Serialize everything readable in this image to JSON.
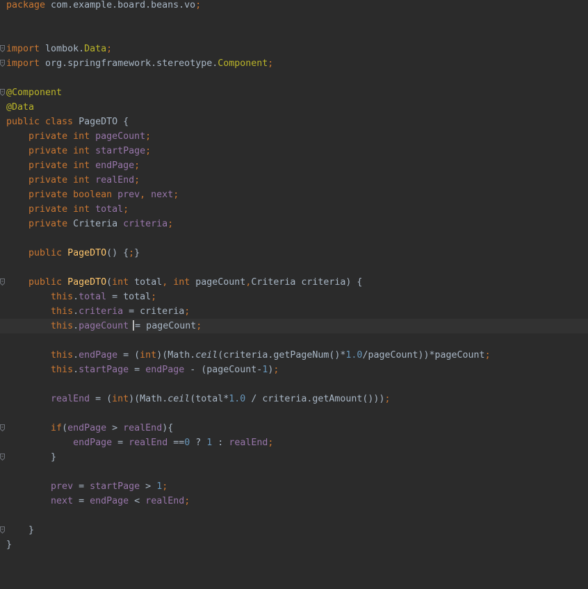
{
  "editor": {
    "language": "Java",
    "colors": {
      "background": "#2b2b2b",
      "current_line": "#323232",
      "keyword": "#cc7832",
      "field": "#9876aa",
      "number": "#6897bb",
      "annotation": "#bbb529",
      "method_decl": "#ffc66d",
      "text": "#a9b7c6"
    },
    "lines": [
      {
        "tokens": [
          [
            "kw",
            "package"
          ],
          [
            "pkg",
            " com.example.board.beans.vo"
          ],
          [
            "pun",
            ";"
          ]
        ]
      },
      {
        "tokens": []
      },
      {
        "tokens": []
      },
      {
        "fold": true,
        "tokens": [
          [
            "kw",
            "import"
          ],
          [
            "pkg",
            " lombok."
          ],
          [
            "ann",
            "Data"
          ],
          [
            "pun",
            ";"
          ]
        ]
      },
      {
        "fold": true,
        "tokens": [
          [
            "kw",
            "import"
          ],
          [
            "pkg",
            " org.springframework.stereotype."
          ],
          [
            "ann",
            "Component"
          ],
          [
            "pun",
            ";"
          ]
        ]
      },
      {
        "tokens": []
      },
      {
        "fold": true,
        "tokens": [
          [
            "ann",
            "@Component"
          ]
        ]
      },
      {
        "tokens": [
          [
            "ann",
            "@Data"
          ]
        ]
      },
      {
        "tokens": [
          [
            "kw",
            "public class "
          ],
          [
            "ty",
            "PageDTO {"
          ]
        ]
      },
      {
        "tokens": [
          [
            "ty",
            "    "
          ],
          [
            "kw",
            "private int "
          ],
          [
            "fld",
            "pageCount"
          ],
          [
            "pun",
            ";"
          ]
        ]
      },
      {
        "tokens": [
          [
            "ty",
            "    "
          ],
          [
            "kw",
            "private int "
          ],
          [
            "fld",
            "startPage"
          ],
          [
            "pun",
            ";"
          ]
        ]
      },
      {
        "tokens": [
          [
            "ty",
            "    "
          ],
          [
            "kw",
            "private int "
          ],
          [
            "fld",
            "endPage"
          ],
          [
            "pun",
            ";"
          ]
        ]
      },
      {
        "tokens": [
          [
            "ty",
            "    "
          ],
          [
            "kw",
            "private int "
          ],
          [
            "fld",
            "realEnd"
          ],
          [
            "pun",
            ";"
          ]
        ]
      },
      {
        "tokens": [
          [
            "ty",
            "    "
          ],
          [
            "kw",
            "private boolean "
          ],
          [
            "fld",
            "prev"
          ],
          [
            "pun",
            ", "
          ],
          [
            "fld",
            "next"
          ],
          [
            "pun",
            ";"
          ]
        ]
      },
      {
        "tokens": [
          [
            "ty",
            "    "
          ],
          [
            "kw",
            "private int "
          ],
          [
            "fld",
            "total"
          ],
          [
            "pun",
            ";"
          ]
        ]
      },
      {
        "tokens": [
          [
            "ty",
            "    "
          ],
          [
            "kw",
            "private "
          ],
          [
            "ty",
            "Criteria "
          ],
          [
            "fld",
            "criteria"
          ],
          [
            "pun",
            ";"
          ]
        ]
      },
      {
        "tokens": []
      },
      {
        "tokens": [
          [
            "ty",
            "    "
          ],
          [
            "kw",
            "public "
          ],
          [
            "mth",
            "PageDTO"
          ],
          [
            "ty",
            "() {"
          ],
          [
            "pun",
            ";"
          ],
          [
            "ty",
            "}"
          ]
        ]
      },
      {
        "tokens": []
      },
      {
        "fold": true,
        "tokens": [
          [
            "ty",
            "    "
          ],
          [
            "kw",
            "public "
          ],
          [
            "mth",
            "PageDTO"
          ],
          [
            "ty",
            "("
          ],
          [
            "kw",
            "int "
          ],
          [
            "ty",
            "total"
          ],
          [
            "pun",
            ", "
          ],
          [
            "kw",
            "int "
          ],
          [
            "ty",
            "pageCount"
          ],
          [
            "pun",
            ","
          ],
          [
            "ty",
            "Criteria criteria) {"
          ]
        ]
      },
      {
        "tokens": [
          [
            "ty",
            "        "
          ],
          [
            "kw",
            "this"
          ],
          [
            "ty",
            "."
          ],
          [
            "fld",
            "total"
          ],
          [
            "ty",
            " = total"
          ],
          [
            "pun",
            ";"
          ]
        ]
      },
      {
        "tokens": [
          [
            "ty",
            "        "
          ],
          [
            "kw",
            "this"
          ],
          [
            "ty",
            "."
          ],
          [
            "fld",
            "criteria"
          ],
          [
            "ty",
            " = criteria"
          ],
          [
            "pun",
            ";"
          ]
        ]
      },
      {
        "current": true,
        "caret_after": 4,
        "tokens": [
          [
            "ty",
            "        "
          ],
          [
            "kw",
            "this"
          ],
          [
            "ty",
            "."
          ],
          [
            "fld",
            "pageCount"
          ],
          [
            "ty",
            " = pageCount"
          ],
          [
            "pun",
            ";"
          ]
        ]
      },
      {
        "tokens": []
      },
      {
        "tokens": [
          [
            "ty",
            "        "
          ],
          [
            "kw",
            "this"
          ],
          [
            "ty",
            "."
          ],
          [
            "fld",
            "endPage"
          ],
          [
            "ty",
            " = ("
          ],
          [
            "kw",
            "int"
          ],
          [
            "ty",
            ")(Math."
          ],
          [
            "sta",
            "ceil"
          ],
          [
            "ty",
            "(criteria.getPageNum()*"
          ],
          [
            "num",
            "1.0"
          ],
          [
            "ty",
            "/pageCount))*pageCount"
          ],
          [
            "pun",
            ";"
          ]
        ]
      },
      {
        "tokens": [
          [
            "ty",
            "        "
          ],
          [
            "kw",
            "this"
          ],
          [
            "ty",
            "."
          ],
          [
            "fld",
            "startPage"
          ],
          [
            "ty",
            " = "
          ],
          [
            "fld",
            "endPage"
          ],
          [
            "ty",
            " - (pageCount-"
          ],
          [
            "num",
            "1"
          ],
          [
            "ty",
            ")"
          ],
          [
            "pun",
            ";"
          ]
        ]
      },
      {
        "tokens": []
      },
      {
        "tokens": [
          [
            "ty",
            "        "
          ],
          [
            "fld",
            "realEnd"
          ],
          [
            "ty",
            " = ("
          ],
          [
            "kw",
            "int"
          ],
          [
            "ty",
            ")(Math."
          ],
          [
            "sta",
            "ceil"
          ],
          [
            "ty",
            "(total*"
          ],
          [
            "num",
            "1.0"
          ],
          [
            "ty",
            " / criteria.getAmount()))"
          ],
          [
            "pun",
            ";"
          ]
        ]
      },
      {
        "tokens": []
      },
      {
        "fold": true,
        "tokens": [
          [
            "ty",
            "        "
          ],
          [
            "kw",
            "if"
          ],
          [
            "ty",
            "("
          ],
          [
            "fld",
            "endPage"
          ],
          [
            "ty",
            " > "
          ],
          [
            "fld",
            "realEnd"
          ],
          [
            "ty",
            "){"
          ]
        ]
      },
      {
        "tokens": [
          [
            "ty",
            "            "
          ],
          [
            "fld",
            "endPage"
          ],
          [
            "ty",
            " = "
          ],
          [
            "fld",
            "realEnd"
          ],
          [
            "ty",
            " =="
          ],
          [
            "num",
            "0"
          ],
          [
            "ty",
            " ? "
          ],
          [
            "num",
            "1"
          ],
          [
            "ty",
            " : "
          ],
          [
            "fld",
            "realEnd"
          ],
          [
            "pun",
            ";"
          ]
        ]
      },
      {
        "fold": true,
        "tokens": [
          [
            "ty",
            "        }"
          ]
        ]
      },
      {
        "tokens": []
      },
      {
        "tokens": [
          [
            "ty",
            "        "
          ],
          [
            "fld",
            "prev"
          ],
          [
            "ty",
            " = "
          ],
          [
            "fld",
            "startPage"
          ],
          [
            "ty",
            " > "
          ],
          [
            "num",
            "1"
          ],
          [
            "pun",
            ";"
          ]
        ]
      },
      {
        "tokens": [
          [
            "ty",
            "        "
          ],
          [
            "fld",
            "next"
          ],
          [
            "ty",
            " = "
          ],
          [
            "fld",
            "endPage"
          ],
          [
            "ty",
            " < "
          ],
          [
            "fld",
            "realEnd"
          ],
          [
            "pun",
            ";"
          ]
        ]
      },
      {
        "tokens": []
      },
      {
        "fold": true,
        "tokens": [
          [
            "ty",
            "    }"
          ]
        ]
      },
      {
        "tokens": [
          [
            "ty",
            "}"
          ]
        ]
      }
    ]
  }
}
